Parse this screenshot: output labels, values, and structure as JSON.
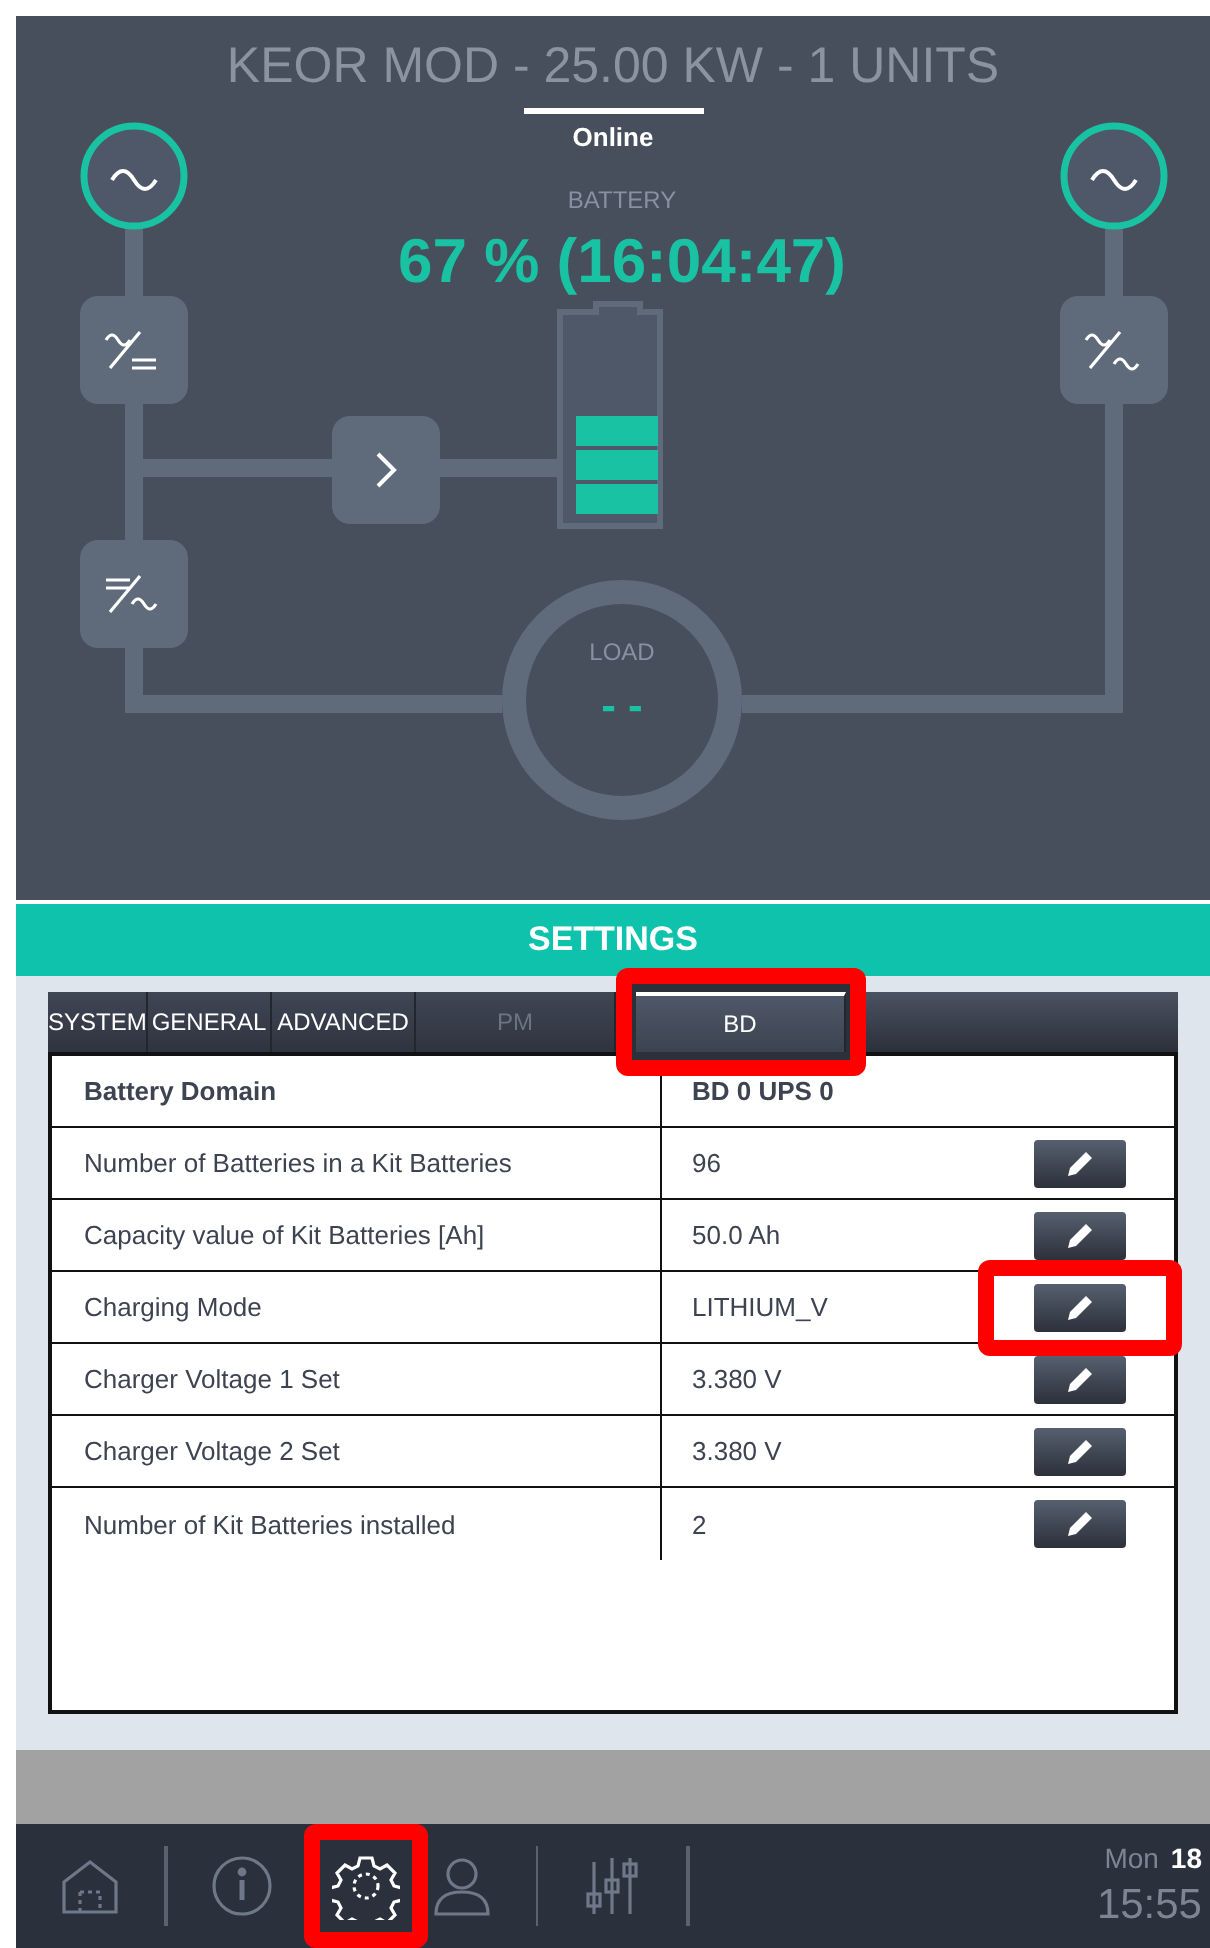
{
  "header": {
    "title": "KEOR MOD - 25.00 KW - 1 UNITS",
    "status": "Online"
  },
  "diagram": {
    "battery": {
      "label": "BATTERY",
      "reading": "67 % (16:04:47)"
    },
    "load": {
      "label": "LOAD",
      "reading": "- -"
    }
  },
  "settings": {
    "title": "SETTINGS",
    "tabs": [
      {
        "label": "SYSTEM",
        "selected": false,
        "disabled": false,
        "highlighted": false
      },
      {
        "label": "GENERAL",
        "selected": false,
        "disabled": false,
        "highlighted": false
      },
      {
        "label": "ADVANCED",
        "selected": false,
        "disabled": false,
        "highlighted": false
      },
      {
        "label": "PM",
        "selected": false,
        "disabled": true,
        "highlighted": false
      },
      {
        "label": "BD",
        "selected": true,
        "disabled": false,
        "highlighted": true
      }
    ],
    "table": {
      "header": {
        "name": "Battery Domain",
        "value": "BD 0 UPS 0"
      },
      "rows": [
        {
          "name": "Number of Batteries in a Kit Batteries",
          "value": "96",
          "highlighted": false
        },
        {
          "name": "Capacity value of Kit Batteries [Ah]",
          "value": "50.0 Ah",
          "highlighted": false
        },
        {
          "name": "Charging Mode",
          "value": "LITHIUM_V",
          "highlighted": true
        },
        {
          "name": "Charger Voltage 1 Set",
          "value": "3.380 V",
          "highlighted": false
        },
        {
          "name": "Charger Voltage 2 Set",
          "value": "3.380 V",
          "highlighted": false
        },
        {
          "name": "Number of Kit Batteries installed",
          "value": "2",
          "highlighted": false
        }
      ]
    }
  },
  "nav": {
    "items": [
      {
        "kind": "home",
        "selected": false,
        "highlighted": false
      },
      {
        "kind": "divider"
      },
      {
        "kind": "info",
        "selected": false,
        "highlighted": false
      },
      {
        "kind": "settings",
        "selected": true,
        "highlighted": true
      },
      {
        "kind": "user",
        "selected": false,
        "highlighted": false
      },
      {
        "kind": "divider"
      },
      {
        "kind": "sliders",
        "selected": false,
        "highlighted": false
      },
      {
        "kind": "divider"
      }
    ],
    "clock": {
      "day": "Mon",
      "date": "18",
      "time": "15:55"
    }
  }
}
